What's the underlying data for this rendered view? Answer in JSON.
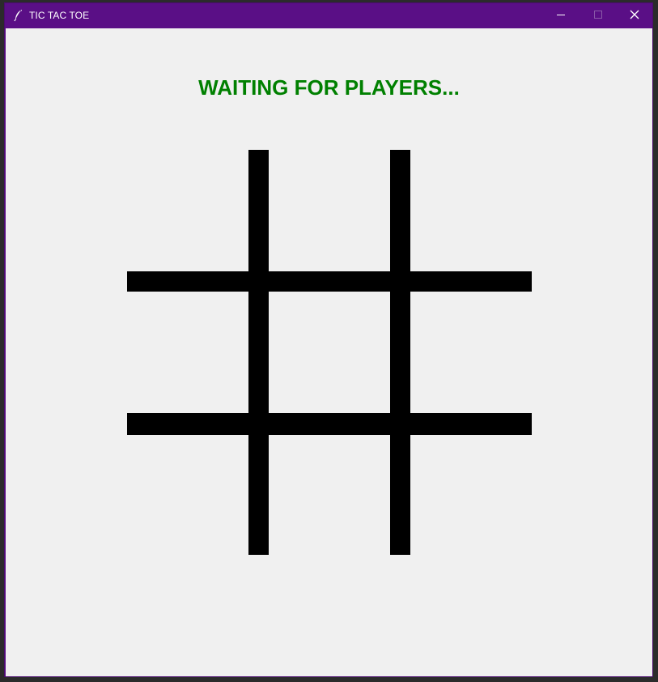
{
  "window": {
    "title": "TIC TAC TOE",
    "title_bar_color": "#5a0f86",
    "app_icon": "feather-icon",
    "controls": {
      "minimize_icon": "minimize-icon",
      "maximize_icon": "maximize-icon",
      "close_icon": "close-icon"
    }
  },
  "game": {
    "status_text": "WAITING FOR PLAYERS...",
    "status_color": "#008000",
    "board": {
      "rows": 3,
      "cols": 3,
      "cells": [
        "",
        "",
        "",
        "",
        "",
        "",
        "",
        "",
        ""
      ],
      "line_color": "#000000"
    }
  }
}
